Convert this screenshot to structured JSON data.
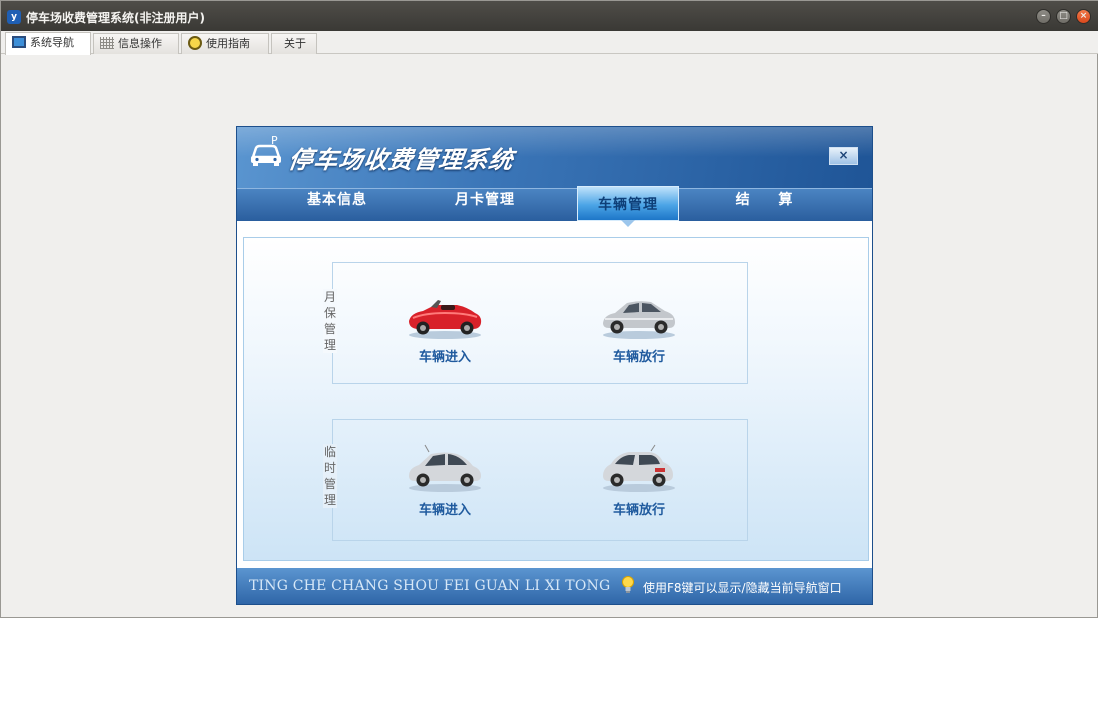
{
  "window": {
    "title": "停车场收费管理系统(非注册用户)",
    "app_icon_letter": "y",
    "buttons": {
      "minimize": "–",
      "maximize": "□",
      "close": "×"
    }
  },
  "tabs": [
    {
      "label": "系统导航",
      "icon": "monitor-icon",
      "active": true
    },
    {
      "label": "信息操作",
      "icon": "grid-icon",
      "active": false
    },
    {
      "label": "使用指南",
      "icon": "help-icon",
      "active": false
    },
    {
      "label": "关于",
      "icon": "",
      "active": false
    }
  ],
  "dialog": {
    "title": "停车场收费管理系统",
    "close_label": "×",
    "nav": [
      "基本信息",
      "月卡管理",
      "车辆管理",
      "结 算"
    ],
    "active_nav": "车辆管理",
    "groups": [
      {
        "label": "月保管理",
        "items": [
          {
            "label": "车辆进入",
            "icon": "red-convertible-car-icon"
          },
          {
            "label": "车辆放行",
            "icon": "silver-sedan-car-icon"
          }
        ]
      },
      {
        "label": "临时管理",
        "items": [
          {
            "label": "车辆进入",
            "icon": "silver-hatchback-car-icon"
          },
          {
            "label": "车辆放行",
            "icon": "silver-hatchback-rear-car-icon"
          }
        ]
      }
    ],
    "footer": {
      "pinyin": "TING CHE CHANG SHOU FEI  GUAN LI XI TONG",
      "tip": "使用F8键可以显示/隐藏当前导航窗口"
    }
  },
  "colors": {
    "titlebar": "#3f3e3a",
    "dialog_header": "#3b76b8",
    "nav_active": "#4ba4e6",
    "caption_text": "#1f5a9e"
  }
}
